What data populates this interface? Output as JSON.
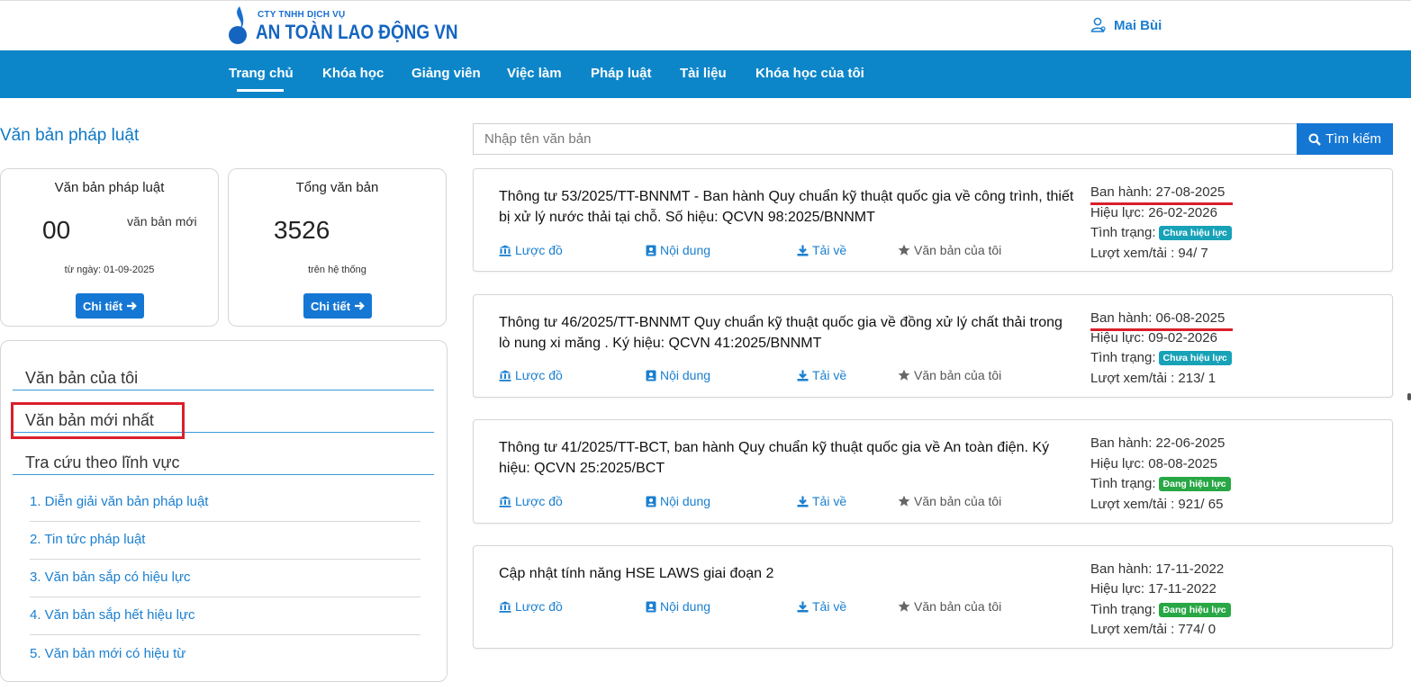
{
  "header": {
    "logo_subtitle": "CTY TNHH DỊCH VỤ",
    "logo_title": "AN TOÀN LAO ĐỘNG VN",
    "user_name": "Mai Bùi",
    "user_icon": "user-icon"
  },
  "nav": {
    "items": [
      "Trang chủ",
      "Khóa học",
      "Giảng viên",
      "Việc làm",
      "Pháp luật",
      "Tài liệu",
      "Khóa học của tôi"
    ],
    "active": "Trang chủ"
  },
  "page_title": "Văn bản pháp luật",
  "stats": [
    {
      "title": "Văn bản pháp luật",
      "number": "00",
      "unit": "văn bản mới",
      "note": "từ ngày: 01-09-2025",
      "button": "Chi tiết"
    },
    {
      "title": "Tổng văn bản",
      "number": "3526",
      "unit": "",
      "note": "trên hệ thống",
      "button": "Chi tiết"
    }
  ],
  "sidebar": {
    "headings": [
      "Văn bản của tôi",
      "Văn bản mới nhất",
      "Tra cứu theo lĩnh vực"
    ],
    "items": [
      "1. Diễn giải văn bản pháp luật",
      "2. Tin tức pháp luật",
      "3. Văn bản sắp có hiệu lực",
      "4. Văn bản sắp hết hiệu lực",
      "5. Văn bản mới có hiệu từ"
    ]
  },
  "search": {
    "placeholder": "Nhập tên văn bản",
    "value": "",
    "button": "Tìm kiếm"
  },
  "doc_actions": {
    "diagram": "Lược đồ",
    "content": "Nội dung",
    "download": "Tải về",
    "mine": "Văn bản của tôi"
  },
  "documents": [
    {
      "title": "Thông tư 53/2025/TT-BNNMT - Ban hành Quy chuẩn kỹ thuật quốc gia về công trình, thiết bị xử lý nước thải tại chỗ. Số hiệu: QCVN 98:2025/BNNMT",
      "issued": "Ban hành: 27-08-2025",
      "effective": "Hiệu lực: 26-02-2026",
      "status_label": "Tình trạng:",
      "status": "Chưa hiệu lực",
      "status_color": "#17a2b8",
      "views": "Lượt xem/tải : 94/ 7"
    },
    {
      "title": "Thông tư 46/2025/TT-BNNMT Quy chuẩn kỹ thuật quốc gia về đồng xử lý chất thải trong lò nung xi măng . Ký hiệu: QCVN 41:2025/BNNMT",
      "issued": "Ban hành: 06-08-2025",
      "effective": "Hiệu lực: 09-02-2026",
      "status_label": "Tình trạng:",
      "status": "Chưa hiệu lực",
      "status_color": "#17a2b8",
      "views": "Lượt xem/tải : 213/ 1"
    },
    {
      "title": "Thông tư 41/2025/TT-BCT, ban hành Quy chuẩn kỹ thuật quốc gia về An toàn điện. Ký hiệu: QCVN 25:2025/BCT",
      "issued": "Ban hành: 22-06-2025",
      "effective": "Hiệu lực: 08-08-2025",
      "status_label": "Tình trạng:",
      "status": "Đang hiệu lực",
      "status_color": "#28a745",
      "views": "Lượt xem/tải : 921/ 65"
    },
    {
      "title": "Cập nhật tính năng HSE LAWS giai đoạn 2",
      "issued": "Ban hành: 17-11-2022",
      "effective": "Hiệu lực: 17-11-2022",
      "status_label": "Tình trạng:",
      "status": "Đang hiệu lực",
      "status_color": "#28a745",
      "views": "Lượt xem/tải : 774/ 0"
    }
  ],
  "annotation_color": "#d9202a"
}
